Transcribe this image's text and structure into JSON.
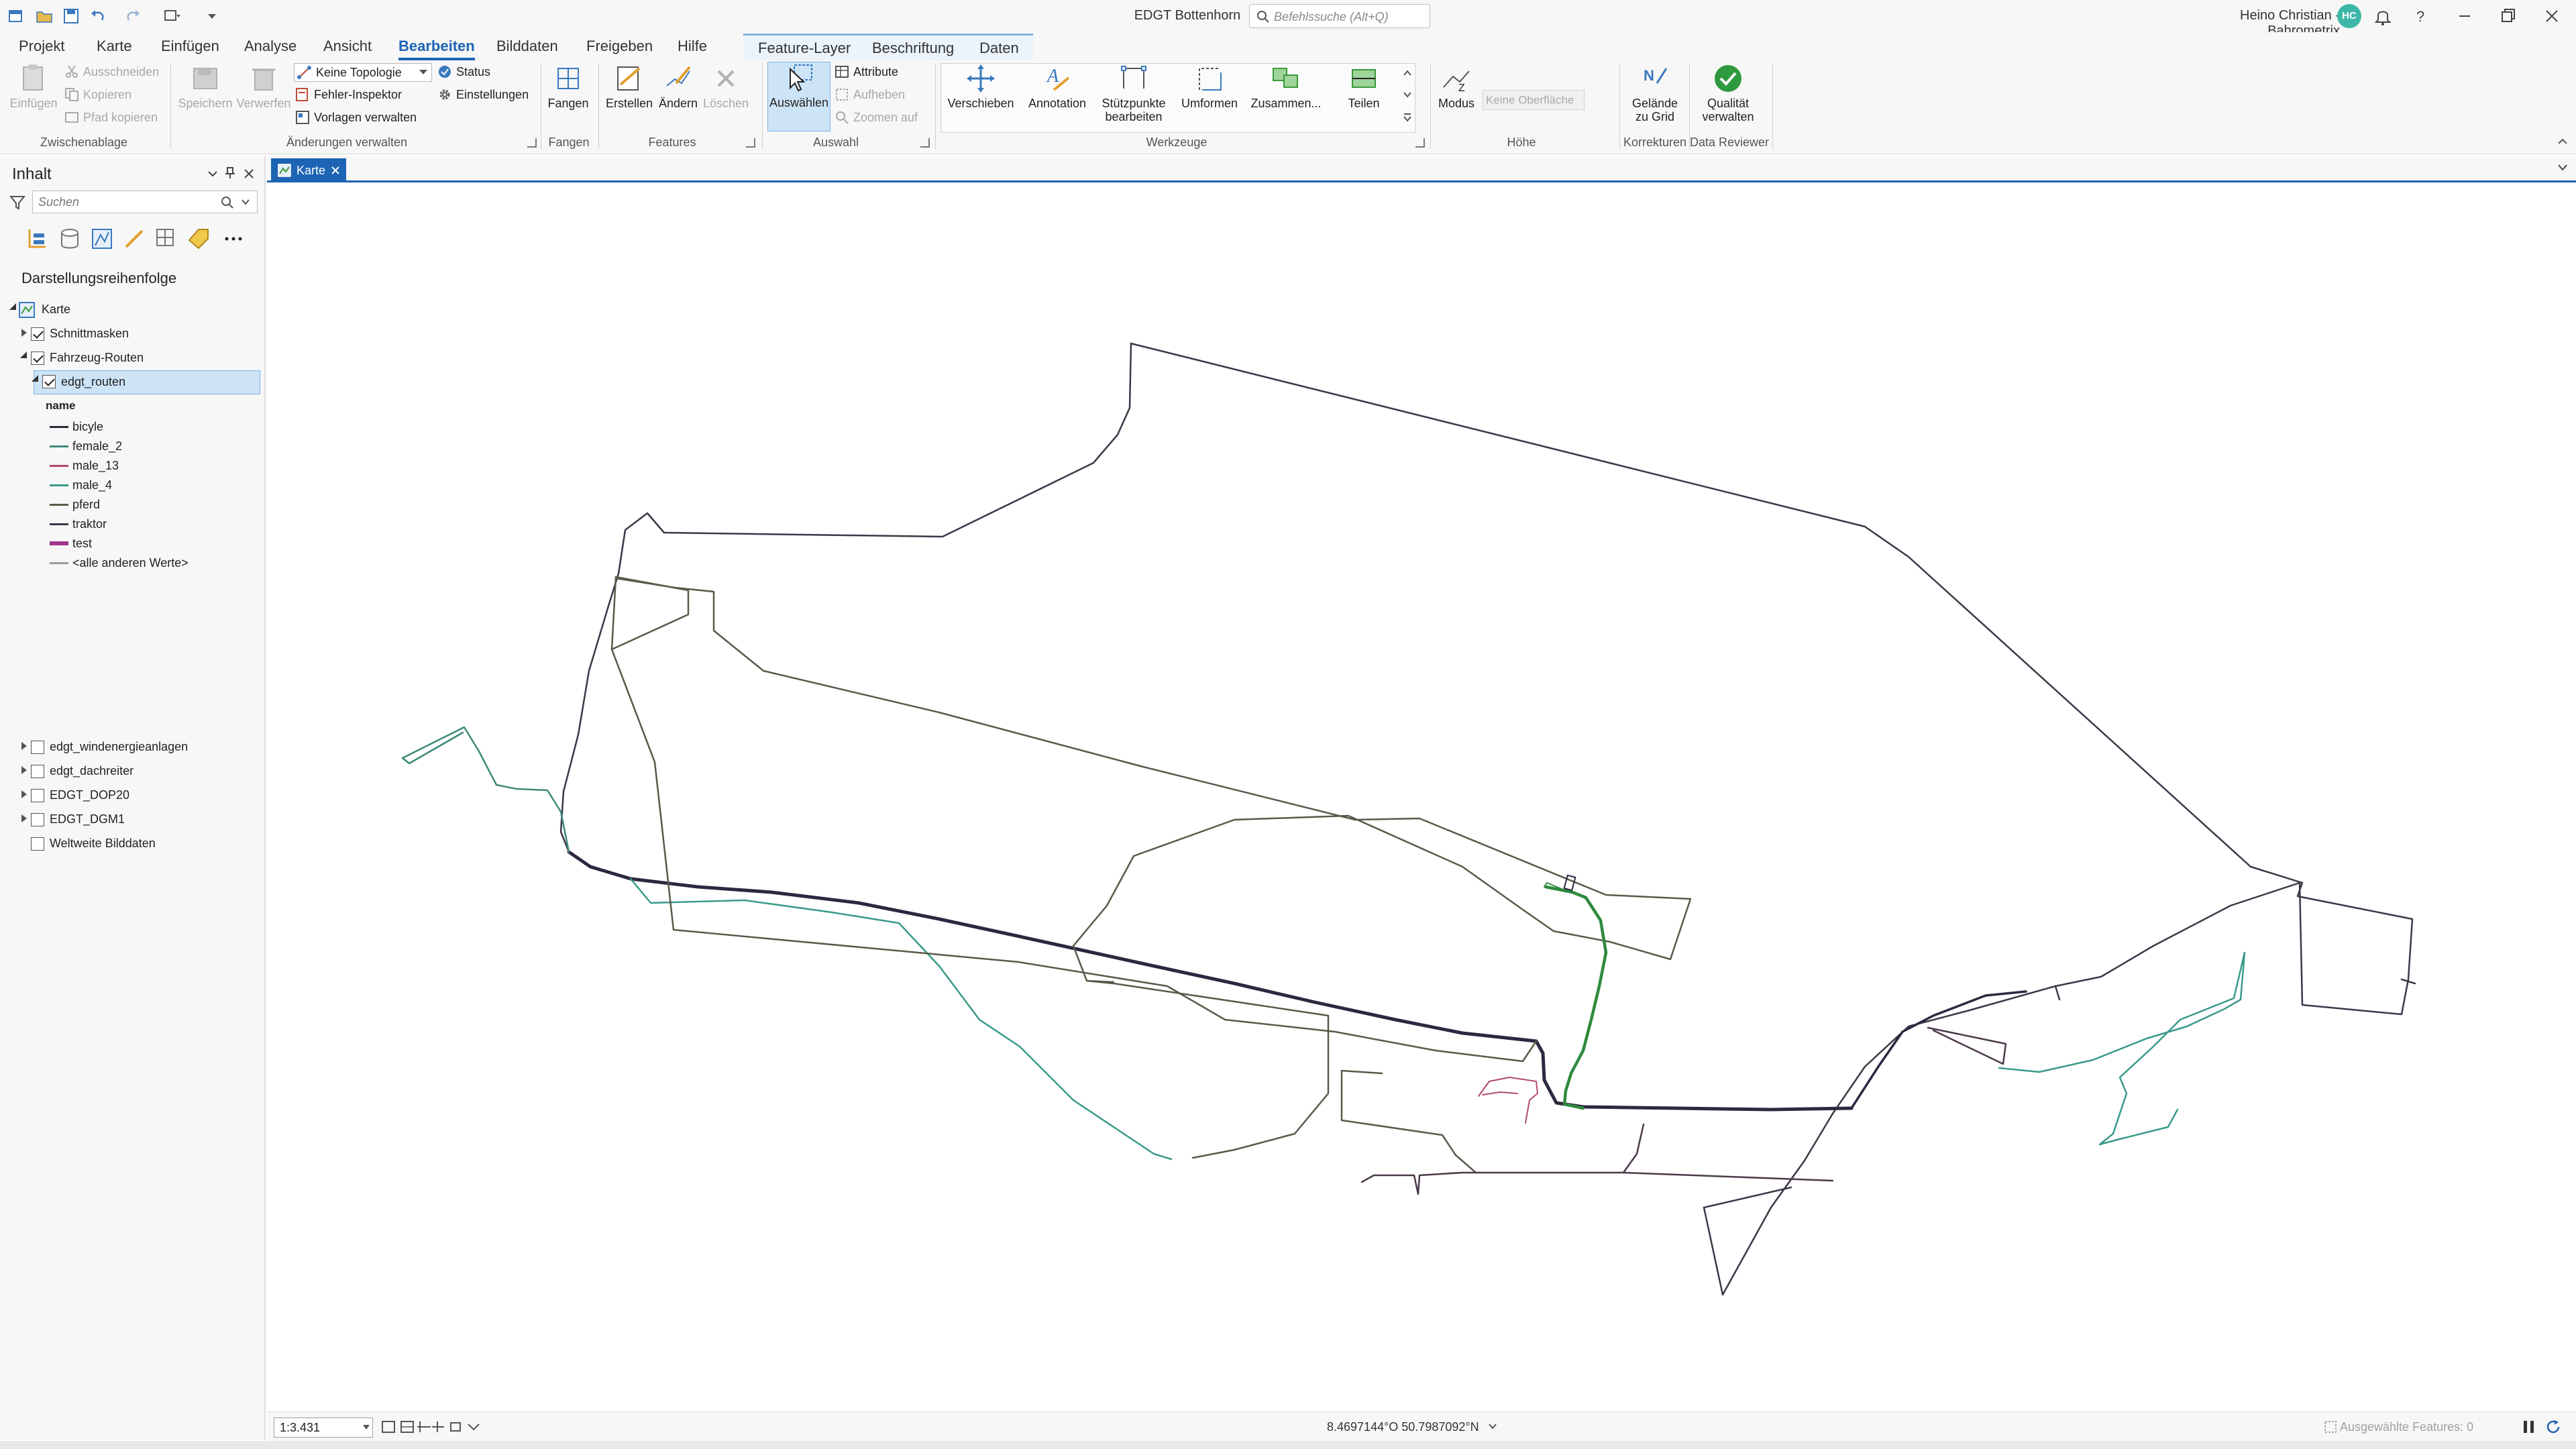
{
  "window": {
    "title": "EDGT Bottenhorn",
    "search_placeholder": "Befehlssuche (Alt+Q)",
    "user_name": "Heino Christian - Bahrometrix",
    "user_initials": "HC"
  },
  "ribbon_tabs": {
    "projekt": "Projekt",
    "karte": "Karte",
    "einfuegen": "Einfügen",
    "analyse": "Analyse",
    "ansicht": "Ansicht",
    "bearbeiten": "Bearbeiten",
    "bilddaten": "Bilddaten",
    "freigeben": "Freigeben",
    "hilfe": "Hilfe",
    "feature_layer": "Feature-Layer",
    "beschriftung": "Beschriftung",
    "daten": "Daten"
  },
  "ribbon": {
    "einfuegen": "Einfügen",
    "ausschneiden": "Ausschneiden",
    "kopieren": "Kopieren",
    "pfad_kopieren": "Pfad kopieren",
    "group_zwischenablage": "Zwischenablage",
    "speichern": "Speichern",
    "verwerfen": "Verwerfen",
    "topologie": "Keine Topologie",
    "status": "Status",
    "fehler_inspektor": "Fehler-Inspektor",
    "einstellungen": "Einstellungen",
    "vorlagen_verwalten": "Vorlagen verwalten",
    "group_aenderungen": "Änderungen verwalten",
    "fangen": "Fangen",
    "group_fangen": "Fangen",
    "erstellen": "Erstellen",
    "aendern": "Ändern",
    "loeschen": "Löschen",
    "group_features": "Features",
    "auswaehlen": "Auswählen",
    "attribute": "Attribute",
    "aufheben": "Aufheben",
    "zoomen_auf": "Zoomen auf",
    "group_auswahl": "Auswahl",
    "verschieben": "Verschieben",
    "annotation": "Annotation",
    "stuetzpunkte_1": "Stützpunkte",
    "stuetzpunkte_2": "bearbeiten",
    "umformen": "Umformen",
    "zusammen": "Zusammen...",
    "teilen": "Teilen",
    "group_werkzeuge": "Werkzeuge",
    "modus": "Modus",
    "keine_oberflaechen": "Keine Oberfläche",
    "group_hoehe": "Höhe",
    "gelaende_1": "Gelände",
    "gelaende_2": "zu Grid",
    "group_korrekturen": "Korrekturen",
    "qualitaet_1": "Qualität",
    "qualitaet_2": "verwalten",
    "group_data_reviewer": "Data Reviewer"
  },
  "contents": {
    "title": "Inhalt",
    "search_placeholder": "Suchen",
    "heading": "Darstellungsreihenfolge",
    "karte": "Karte",
    "schnittmasken": "Schnittmasken",
    "fahrzeug_routen": "Fahrzeug-Routen",
    "edgt_routen": "edgt_routen",
    "field_name": "name",
    "legend": [
      {
        "label": "bicyle",
        "color": "#2b2b3a"
      },
      {
        "label": "female_2",
        "color": "#3d8a7a"
      },
      {
        "label": "male_13",
        "color": "#b04a6a"
      },
      {
        "label": "male_4",
        "color": "#3a9a8a"
      },
      {
        "label": "pferd",
        "color": "#5a5a4a"
      },
      {
        "label": "traktor",
        "color": "#3a3a4a"
      },
      {
        "label": "test",
        "color": "#a0368c"
      },
      {
        "label": "<alle anderen Werte>",
        "color": "#9a9a9a"
      }
    ],
    "windenergie": "edgt_windenergieanlagen",
    "dachreiter": "edgt_dachreiter",
    "dop20": "EDGT_DOP20",
    "dgm1": "EDGT_DGM1",
    "weltweite": "Weltweite Bilddaten"
  },
  "map": {
    "tab_label": "Karte",
    "scale": "1:3.431",
    "coordinates": "8.4697144°O 50.7987092°N",
    "selected_features": "Ausgewählte Features: 0"
  }
}
